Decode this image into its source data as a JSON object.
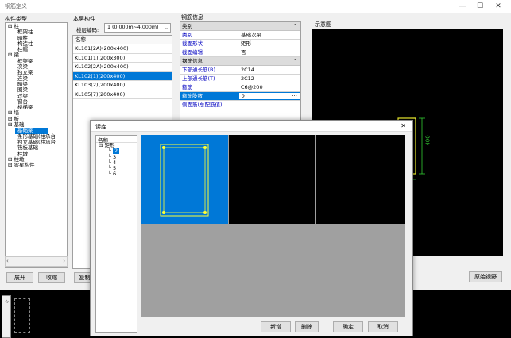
{
  "window": {
    "title": "钢筋定义",
    "min": "—",
    "max": "☐",
    "close": "✕"
  },
  "left_panel": {
    "title": "构件类型",
    "tree": [
      {
        "indent": 0,
        "text": "⊟ 柱"
      },
      {
        "indent": 2,
        "text": "框架柱"
      },
      {
        "indent": 2,
        "text": "暗柱"
      },
      {
        "indent": 2,
        "text": "构造柱"
      },
      {
        "indent": 2,
        "text": "柱帽"
      },
      {
        "indent": 0,
        "text": "⊟ 梁"
      },
      {
        "indent": 2,
        "text": "框架梁"
      },
      {
        "indent": 2,
        "text": "次梁"
      },
      {
        "indent": 2,
        "text": "独立梁"
      },
      {
        "indent": 2,
        "text": "连梁"
      },
      {
        "indent": 2,
        "text": "暗梁"
      },
      {
        "indent": 2,
        "text": "圈梁"
      },
      {
        "indent": 2,
        "text": "过梁"
      },
      {
        "indent": 2,
        "text": "窗台"
      },
      {
        "indent": 2,
        "text": "楼梯梁"
      },
      {
        "indent": 0,
        "text": "⊞ 墙"
      },
      {
        "indent": 0,
        "text": "⊞ 板"
      },
      {
        "indent": 0,
        "text": "⊟ 基础"
      },
      {
        "indent": 2,
        "text": "基础梁",
        "selected": true
      },
      {
        "indent": 2,
        "text": "条形基础(柱承台"
      },
      {
        "indent": 2,
        "text": "独立基础(柱承台"
      },
      {
        "indent": 2,
        "text": "筏板基础"
      },
      {
        "indent": 2,
        "text": "柱墩"
      },
      {
        "indent": 0,
        "text": "⊞ 柱墩"
      },
      {
        "indent": 0,
        "text": "⊞ 零星构件"
      }
    ],
    "expand_btn": "展开",
    "collapse_btn": "收缩"
  },
  "mid_panel": {
    "title": "本层构件",
    "floor_label": "楼层编码:",
    "floor_value": "1 (0.000m~4.000m)",
    "col_header": "名称",
    "items": [
      {
        "text": "KL101(2A)(200x400)"
      },
      {
        "text": "KL101(1)(200x300)"
      },
      {
        "text": "KL102(2A)(200x400)"
      },
      {
        "text": "KL102(1)(200x400)",
        "selected": true
      },
      {
        "text": "KL103(2)(200x400)"
      },
      {
        "text": "KL105(7)(200x400)"
      }
    ],
    "copy_btn": "复制到"
  },
  "prop_panel": {
    "title": "钢筋信息",
    "head1": "类别",
    "rows1": [
      {
        "k": "类别",
        "v": "基础次梁"
      },
      {
        "k": "截面形状",
        "v": "矩形"
      },
      {
        "k": "截面编辑",
        "v": "否"
      }
    ],
    "head2": "钢筋信息",
    "rows2": [
      {
        "k": "下部通长筋(B)",
        "v": "2C14"
      },
      {
        "k": "上部通长筋(T)",
        "v": "2C12"
      },
      {
        "k": "箍筋",
        "v": "C6@200"
      },
      {
        "k": "箍筋肢数",
        "v": "2",
        "active": true
      },
      {
        "k": "侧面筋(总配筋值)",
        "v": ""
      }
    ]
  },
  "preview_panel": {
    "title": "示意图",
    "dim_label": "400",
    "btn": "原始视野"
  },
  "dialog": {
    "title": "读库",
    "close": "✕",
    "col_header": "名称",
    "tree_root": "⊟ 矩形",
    "tree_items": [
      "2",
      "3",
      "4",
      "5",
      "6"
    ],
    "selected_item": "2",
    "buttons": {
      "add": "新增",
      "delete": "删除",
      "ok": "确定",
      "cancel": "取消"
    }
  },
  "colors": {
    "accent": "#0078d7",
    "canvas": "#000000",
    "rebar": "#ffff33",
    "dim": "#33cc33"
  }
}
